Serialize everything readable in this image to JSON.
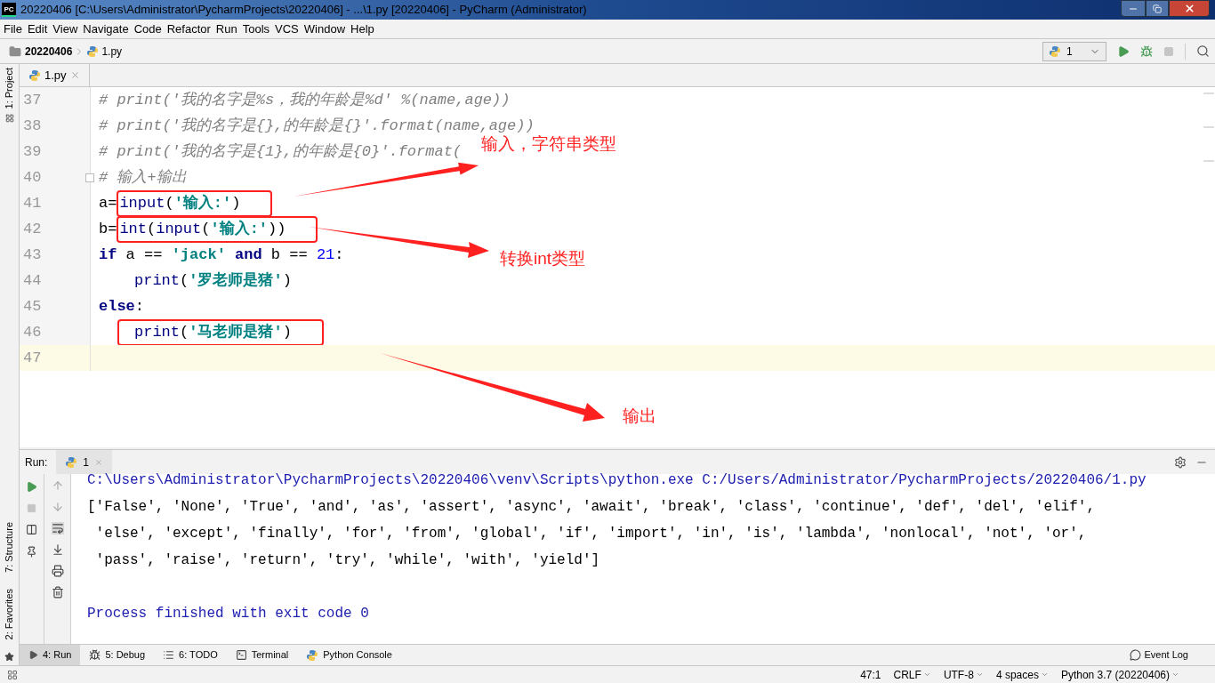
{
  "window": {
    "title": "20220406 [C:\\Users\\Administrator\\PycharmProjects\\20220406] - ...\\1.py [20220406] - PyCharm (Administrator)",
    "app_badge": "PC"
  },
  "menu": [
    "File",
    "Edit",
    "View",
    "Navigate",
    "Code",
    "Refactor",
    "Run",
    "Tools",
    "VCS",
    "Window",
    "Help"
  ],
  "breadcrumb": [
    "20220406",
    "1.py"
  ],
  "run_config": "1",
  "left_tools": [
    "1: Project",
    "7: Structure",
    "2: Favorites"
  ],
  "editor_tabs": [
    {
      "label": "1.py",
      "selected": true
    }
  ],
  "code_lines": [
    {
      "number": "37",
      "current": false,
      "fold": false,
      "indented": false,
      "tokens": [
        {
          "kind": "comment",
          "text": "# print('我的名字是%s，我的年龄是%d' %(name,age))"
        }
      ]
    },
    {
      "number": "38",
      "current": false,
      "fold": false,
      "indented": false,
      "tokens": [
        {
          "kind": "comment",
          "text": "# print('我的名字是{},的年龄是{}'.format(name,age))"
        }
      ]
    },
    {
      "number": "39",
      "current": false,
      "fold": false,
      "indented": false,
      "tokens": [
        {
          "kind": "comment",
          "text": "# print('我的名字是{1},的年龄是{0}'.format("
        }
      ]
    },
    {
      "number": "40",
      "current": false,
      "fold": true,
      "indented": false,
      "tokens": [
        {
          "kind": "comment",
          "text": "# 输入+输出"
        }
      ]
    },
    {
      "number": "41",
      "current": false,
      "fold": false,
      "indented": false,
      "tokens": [
        {
          "kind": "plain",
          "text": "a="
        }
      ],
      "boxed_tokens": [
        {
          "kind": "builtin",
          "text": "input"
        },
        {
          "kind": "plain",
          "text": "("
        },
        {
          "kind": "string",
          "text": "'输入:'"
        },
        {
          "kind": "plain",
          "text": ")"
        }
      ]
    },
    {
      "number": "42",
      "current": false,
      "fold": false,
      "indented": false,
      "tokens": [
        {
          "kind": "plain",
          "text": "b="
        }
      ],
      "boxed_tokens": [
        {
          "kind": "builtin",
          "text": "int"
        },
        {
          "kind": "plain",
          "text": "("
        },
        {
          "kind": "builtin",
          "text": "input"
        },
        {
          "kind": "plain",
          "text": "("
        },
        {
          "kind": "string",
          "text": "'输入:'"
        },
        {
          "kind": "plain",
          "text": "))"
        }
      ]
    },
    {
      "number": "43",
      "current": false,
      "fold": false,
      "indented": false,
      "tokens": [
        {
          "kind": "keyword",
          "text": "if"
        },
        {
          "kind": "plain",
          "text": " a == "
        },
        {
          "kind": "string",
          "text": "'jack'"
        },
        {
          "kind": "keyword",
          "text": " and"
        },
        {
          "kind": "plain",
          "text": " b == "
        },
        {
          "kind": "number",
          "text": "21"
        },
        {
          "kind": "plain",
          "text": ":"
        }
      ]
    },
    {
      "number": "44",
      "current": false,
      "fold": false,
      "indented": true,
      "tokens": [
        {
          "kind": "builtin",
          "text": "print"
        },
        {
          "kind": "plain",
          "text": "("
        },
        {
          "kind": "string",
          "text": "'罗老师是猪'"
        },
        {
          "kind": "plain",
          "text": ")"
        }
      ]
    },
    {
      "number": "45",
      "current": false,
      "fold": false,
      "indented": false,
      "tokens": [
        {
          "kind": "keyword",
          "text": "else"
        },
        {
          "kind": "plain",
          "text": ":"
        }
      ]
    },
    {
      "number": "46",
      "current": false,
      "fold": false,
      "indented": true,
      "boxed_tokens": [
        {
          "kind": "builtin",
          "text": "print"
        },
        {
          "kind": "plain",
          "text": "("
        },
        {
          "kind": "string",
          "text": "'马老师是猪'"
        },
        {
          "kind": "plain",
          "text": ")"
        }
      ]
    },
    {
      "number": "47",
      "current": true,
      "fold": false
    }
  ],
  "annotations": [
    "输入，字符串类型",
    "转换int类型",
    "输出"
  ],
  "run_panel": {
    "label": "Run:",
    "tab": "1",
    "output": [
      {
        "kind": "command",
        "text": "C:\\Users\\Administrator\\PycharmProjects\\20220406\\venv\\Scripts\\python.exe C:/Users/Administrator/PycharmProjects/20220406/1.py"
      },
      {
        "kind": "stdout",
        "text": "['False', 'None', 'True', 'and', 'as', 'assert', 'async', 'await', 'break', 'class', 'continue', 'def', 'del', 'elif',"
      },
      {
        "kind": "stdout",
        "text": " 'else', 'except', 'finally', 'for', 'from', 'global', 'if', 'import', 'in', 'is', 'lambda', 'nonlocal', 'not', 'or',"
      },
      {
        "kind": "stdout",
        "text": " 'pass', 'raise', 'return', 'try', 'while', 'with', 'yield']"
      },
      {
        "kind": "exit",
        "text": "Process finished with exit code 0"
      }
    ]
  },
  "bottom_tabs": [
    {
      "label": "4: Run",
      "kind": "run",
      "selected": true
    },
    {
      "label": "5: Debug",
      "kind": "debug",
      "selected": false
    },
    {
      "label": "6: TODO",
      "kind": "todo",
      "selected": false
    },
    {
      "label": "Terminal",
      "kind": "terminal",
      "selected": false
    },
    {
      "label": "Python Console",
      "kind": "console",
      "selected": false
    }
  ],
  "event_log": "Event Log",
  "status_bar": [
    {
      "text": "47:1",
      "dropdown": false
    },
    {
      "text": "CRLF",
      "dropdown": true
    },
    {
      "text": "UTF-8",
      "dropdown": true
    },
    {
      "text": "4 spaces",
      "dropdown": true
    },
    {
      "text": "Python 3.7 (20220406)",
      "dropdown": true
    }
  ]
}
